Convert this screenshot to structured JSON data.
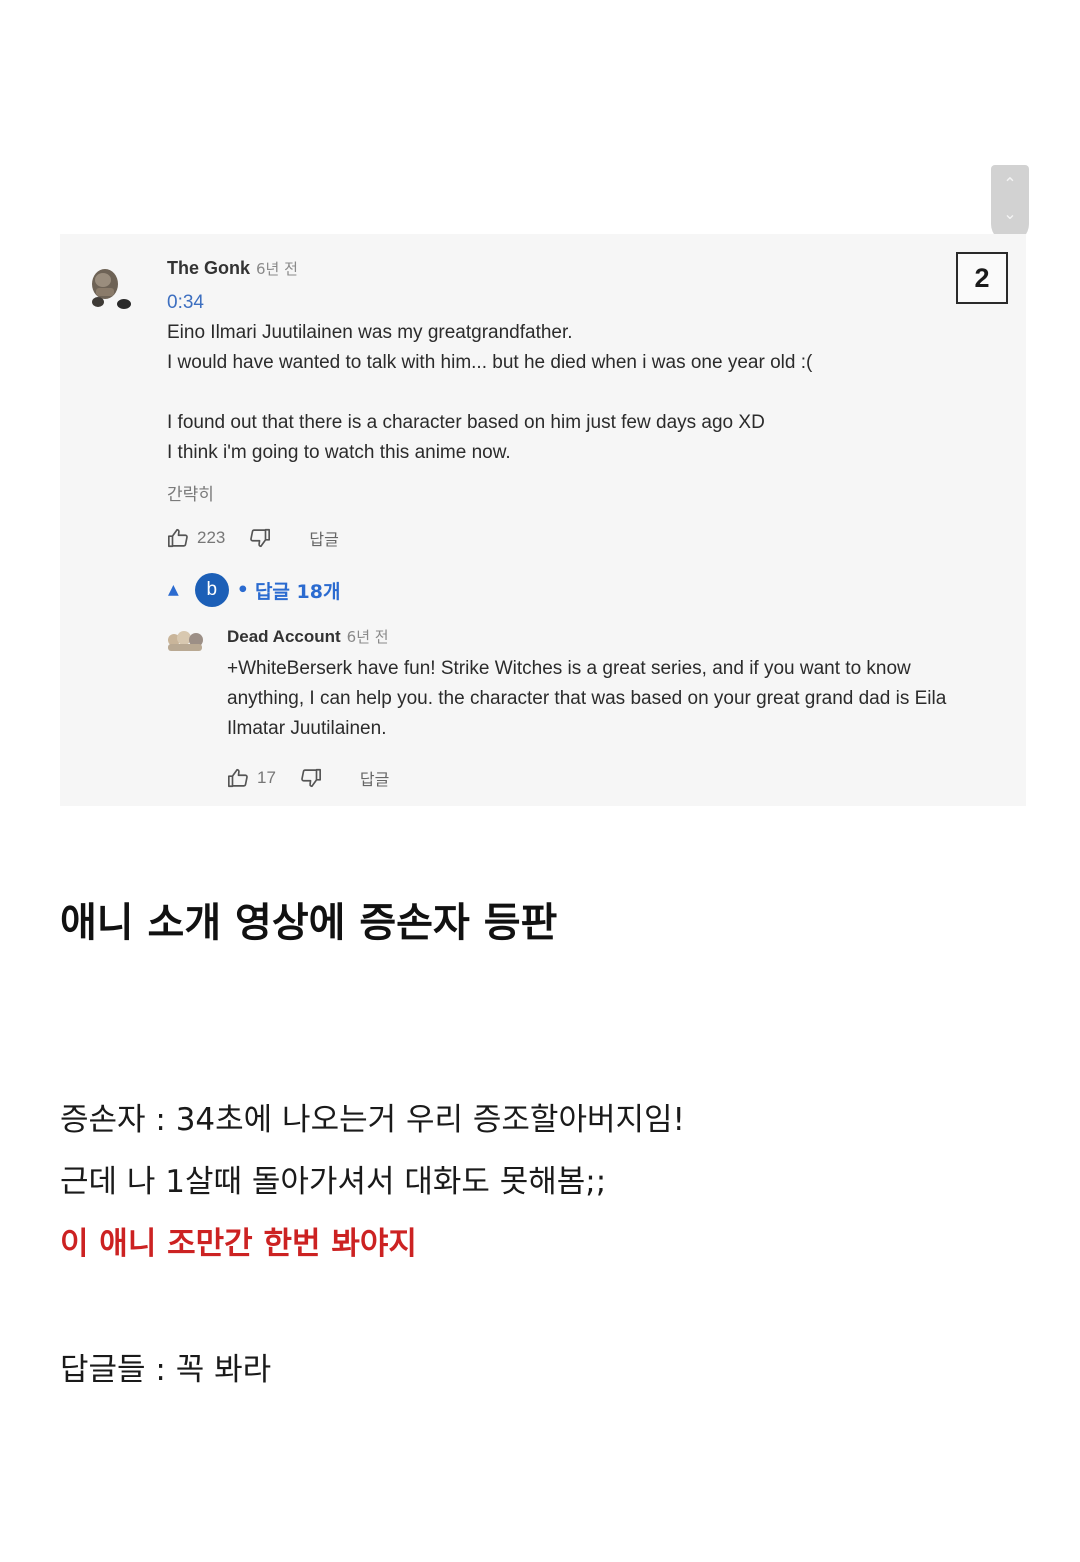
{
  "badge": {
    "page_number": "2"
  },
  "comment": {
    "author": "The Gonk",
    "age": "6년 전",
    "timestamp_link": "0:34",
    "lines": [
      "Eino Ilmari Juutilainen was my greatgrandfather.",
      "I would have wanted to talk with him... but he died when i was one year old :(",
      "I found out that there is a character based on him just few days ago XD",
      "I think i'm going to watch this anime now."
    ],
    "collapse_label": "간략히",
    "likes": "223",
    "reply_label": "답글"
  },
  "replies_toggle": {
    "avatar_letter": "b",
    "dot": "•",
    "label": "답글 18개"
  },
  "reply": {
    "author": "Dead Account",
    "age": "6년 전",
    "lines": [
      "+WhiteBerserk have fun! Strike Witches is a great series, and if you want to know",
      "anything, I can help you. the character that was based on your great grand dad is Eila",
      "Ilmatar Juutilainen."
    ],
    "likes": "17",
    "reply_label": "답글"
  },
  "caption": {
    "headline": "애니 소개 영상에 증손자 등판",
    "line1": "증손자 : 34초에 나오는거 우리 증조할아버지임!",
    "line2": "근데 나 1살때 돌아가셔서 대화도 못해봄;;",
    "line3_red": "이 애니 조만간 한번 봐야지",
    "line4": "답글들 : 꼭 봐라"
  },
  "colors": {
    "link_blue": "#2b6bd0",
    "timestamp_blue": "#3d6fc0",
    "highlight_red": "#cc2222",
    "panel_bg": "#f6f6f6"
  }
}
